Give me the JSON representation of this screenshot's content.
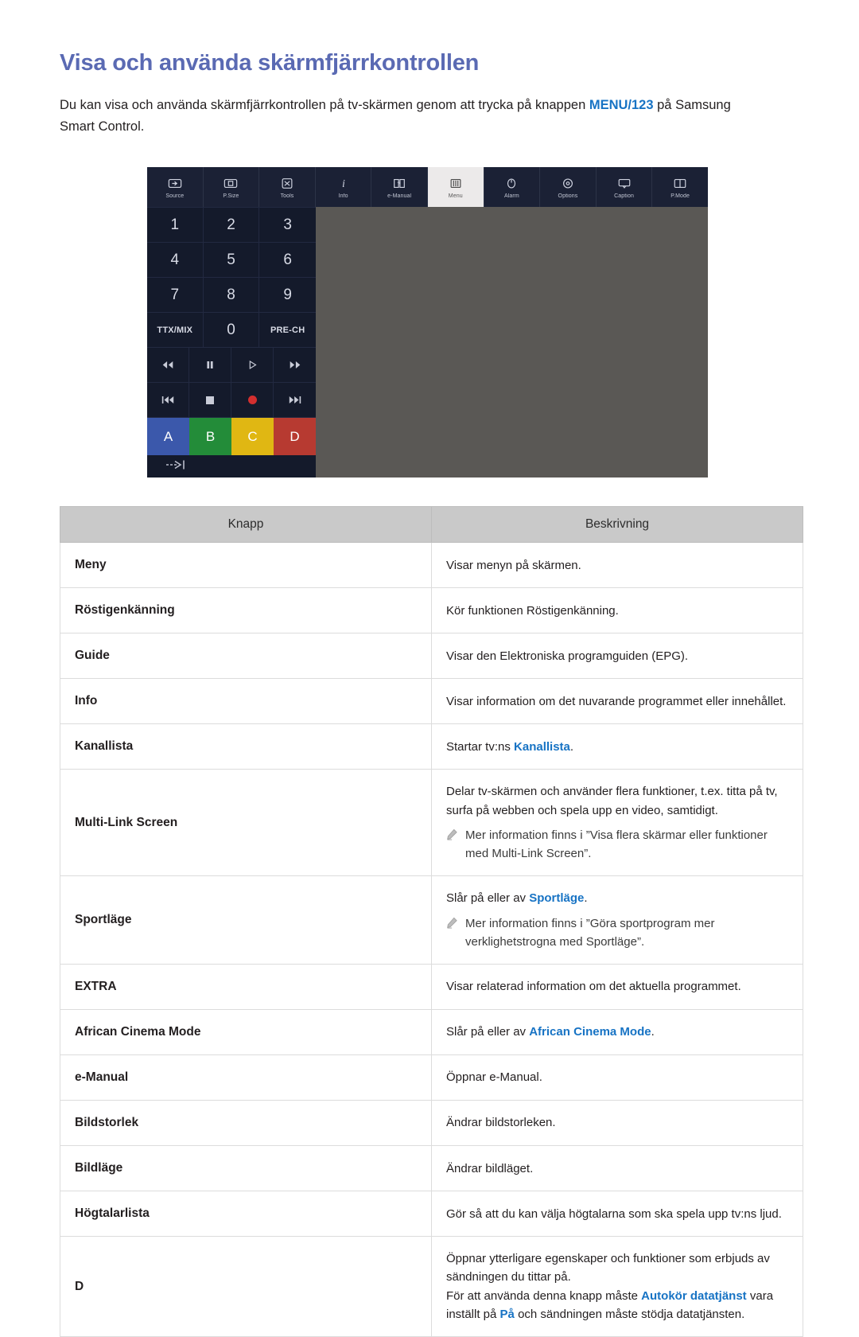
{
  "page": {
    "title": "Visa och använda skärmfjärrkontrollen",
    "intro_before": "Du kan visa och använda skärmfjärrkontrollen på tv-skärmen genom att trycka på knappen ",
    "intro_keyword": "MENU/123",
    "intro_after": " på Samsung Smart Control."
  },
  "colors": {
    "title_blue": "#5a6ab3",
    "link_blue": "#1773c4",
    "toolbar_bg": "#1b2135",
    "keypad_bg": "#141a2b",
    "panel_gray": "#5a5855",
    "header_gray": "#c9c9c9",
    "color_a": "#3b58ab",
    "color_b": "#238c39",
    "color_c": "#e0b713",
    "color_d": "#b73a31",
    "record_red": "#d32f2f"
  },
  "remote": {
    "toolbar": [
      {
        "label": "Source",
        "icon": "source-icon",
        "active": false
      },
      {
        "label": "P.Size",
        "icon": "picture-size-icon",
        "active": false
      },
      {
        "label": "Tools",
        "icon": "tools-icon",
        "active": false
      },
      {
        "label": "Info",
        "icon": "info-icon",
        "active": false
      },
      {
        "label": "e-Manual",
        "icon": "e-manual-icon",
        "active": false
      },
      {
        "label": "Menu",
        "icon": "menu-icon",
        "active": true
      },
      {
        "label": "Alarm",
        "icon": "alarm-icon",
        "active": false
      },
      {
        "label": "Options",
        "icon": "options-icon",
        "active": false
      },
      {
        "label": "Caption",
        "icon": "caption-icon",
        "active": false
      },
      {
        "label": "P.Mode",
        "icon": "picture-mode-icon",
        "active": false
      }
    ],
    "keypad": [
      "1",
      "2",
      "3",
      "4",
      "5",
      "6",
      "7",
      "8",
      "9",
      "TTX/MIX",
      "0",
      "PRE-CH"
    ],
    "media_row1": [
      {
        "name": "rewind-icon",
        "glyph": "◀◀"
      },
      {
        "name": "pause-icon",
        "glyph": "❚❚"
      },
      {
        "name": "play-icon",
        "glyph": "▶"
      },
      {
        "name": "fast-forward-icon",
        "glyph": "▶▶"
      }
    ],
    "media_row2": [
      {
        "name": "previous-track-icon",
        "glyph": "◀◀❙"
      },
      {
        "name": "stop-icon",
        "glyph": ""
      },
      {
        "name": "record-icon",
        "glyph": ""
      },
      {
        "name": "next-track-icon",
        "glyph": "❙▶▶"
      }
    ],
    "color_buttons": [
      "A",
      "B",
      "C",
      "D"
    ],
    "exit_icon": "exit-arrow-icon"
  },
  "table": {
    "headers": [
      "Knapp",
      "Beskrivning"
    ],
    "rows": [
      {
        "key": "Meny",
        "lines": [
          {
            "segments": [
              {
                "t": "Visar menyn på skärmen.",
                "kw": false
              }
            ]
          }
        ]
      },
      {
        "key": "Röstigenkänning",
        "lines": [
          {
            "segments": [
              {
                "t": "Kör funktionen Röstigenkänning.",
                "kw": false
              }
            ]
          }
        ]
      },
      {
        "key": "Guide",
        "lines": [
          {
            "segments": [
              {
                "t": "Visar den Elektroniska programguiden (EPG).",
                "kw": false
              }
            ]
          }
        ]
      },
      {
        "key": "Info",
        "lines": [
          {
            "segments": [
              {
                "t": "Visar information om det nuvarande programmet eller innehållet.",
                "kw": false
              }
            ]
          }
        ]
      },
      {
        "key": "Kanallista",
        "lines": [
          {
            "segments": [
              {
                "t": "Startar tv:ns ",
                "kw": false
              },
              {
                "t": "Kanallista",
                "kw": true
              },
              {
                "t": ".",
                "kw": false
              }
            ]
          }
        ]
      },
      {
        "key": "Multi-Link Screen",
        "lines": [
          {
            "segments": [
              {
                "t": "Delar tv-skärmen och använder flera funktioner, t.ex. titta på tv, surfa på webben och spela upp en video, samtidigt.",
                "kw": false
              }
            ]
          }
        ],
        "note": "Mer information finns i ”Visa flera skärmar eller funktioner med Multi-Link Screen”."
      },
      {
        "key": "Sportläge",
        "lines": [
          {
            "segments": [
              {
                "t": "Slår på eller av ",
                "kw": false
              },
              {
                "t": "Sportläge",
                "kw": true
              },
              {
                "t": ".",
                "kw": false
              }
            ]
          }
        ],
        "note": "Mer information finns i ”Göra sportprogram mer verklighetstrogna med Sportläge”."
      },
      {
        "key": "EXTRA",
        "lines": [
          {
            "segments": [
              {
                "t": "Visar relaterad information om det aktuella programmet.",
                "kw": false
              }
            ]
          }
        ]
      },
      {
        "key": "African Cinema Mode",
        "lines": [
          {
            "segments": [
              {
                "t": "Slår på eller av ",
                "kw": false
              },
              {
                "t": "African Cinema Mode",
                "kw": true
              },
              {
                "t": ".",
                "kw": false
              }
            ]
          }
        ]
      },
      {
        "key": "e-Manual",
        "lines": [
          {
            "segments": [
              {
                "t": "Öppnar e-Manual.",
                "kw": false
              }
            ]
          }
        ]
      },
      {
        "key": "Bildstorlek",
        "lines": [
          {
            "segments": [
              {
                "t": "Ändrar bildstorleken.",
                "kw": false
              }
            ]
          }
        ]
      },
      {
        "key": "Bildläge",
        "lines": [
          {
            "segments": [
              {
                "t": "Ändrar bildläget.",
                "kw": false
              }
            ]
          }
        ]
      },
      {
        "key": "Högtalarlista",
        "lines": [
          {
            "segments": [
              {
                "t": "Gör så att du kan välja högtalarna som ska spela upp tv:ns ljud.",
                "kw": false
              }
            ]
          }
        ]
      },
      {
        "key": "D",
        "lines": [
          {
            "segments": [
              {
                "t": "Öppnar ytterligare egenskaper och funktioner som erbjuds av sändningen du tittar på.",
                "kw": false
              }
            ]
          },
          {
            "segments": [
              {
                "t": "För att använda denna knapp måste ",
                "kw": false
              },
              {
                "t": "Autokör datatjänst",
                "kw": true
              },
              {
                "t": " vara inställt på ",
                "kw": false
              },
              {
                "t": "På",
                "kw": true
              },
              {
                "t": " och sändningen måste stödja datatjänsten.",
                "kw": false
              }
            ]
          }
        ]
      }
    ]
  }
}
